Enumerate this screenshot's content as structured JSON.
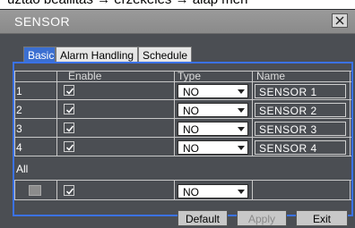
{
  "caption": "úztao beallitas → erzekeles → alap men",
  "window": {
    "title": "SENSOR"
  },
  "tabs": [
    {
      "label": "Basic",
      "active": true
    },
    {
      "label": "Alarm Handling",
      "active": false
    },
    {
      "label": "Schedule",
      "active": false
    }
  ],
  "table": {
    "headers": [
      "Enable",
      "Type",
      "Name"
    ],
    "rows": [
      {
        "num": "1",
        "enabled": true,
        "type": "NO",
        "name": "SENSOR 1"
      },
      {
        "num": "2",
        "enabled": true,
        "type": "NO",
        "name": "SENSOR 2"
      },
      {
        "num": "3",
        "enabled": true,
        "type": "NO",
        "name": "SENSOR 3"
      },
      {
        "num": "4",
        "enabled": true,
        "type": "NO",
        "name": "SENSOR 4"
      }
    ],
    "all_label": "All",
    "all_row": {
      "enabled": true,
      "type": "NO"
    }
  },
  "buttons": {
    "default_label": "Default",
    "apply_label": "Apply",
    "exit_label": "Exit"
  },
  "colors": {
    "accent": "#3b72e6",
    "tab_active": "#3b6fd1",
    "background": "#4b4e53"
  }
}
